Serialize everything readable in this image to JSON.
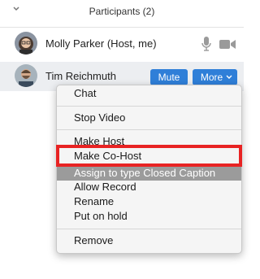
{
  "header": {
    "title": "Participants (2)",
    "collapse_icon": "chevron-down-icon"
  },
  "participants": [
    {
      "name": "Molly Parker (Host, me)",
      "icons": [
        "microphone-icon",
        "video-camera-icon"
      ]
    },
    {
      "name": "Tim Reichmuth",
      "mute_label": "Mute",
      "more_label": "More"
    }
  ],
  "menu": {
    "items": {
      "chat": "Chat",
      "stop_video": "Stop Video",
      "make_host": "Make Host",
      "make_cohost": "Make Co-Host",
      "assign_cc": "Assign to type Closed Caption",
      "allow_record": "Allow Record",
      "rename": "Rename",
      "put_on_hold": "Put on hold",
      "remove": "Remove"
    },
    "selected_item": "Assign to type Closed Caption",
    "highlighted_item": "Make Co-Host"
  },
  "colors": {
    "button_blue": "#2f7fd8",
    "highlight_red": "#e82323",
    "selected_gray": "#9b9b9b",
    "row_hover": "#eceef1"
  }
}
